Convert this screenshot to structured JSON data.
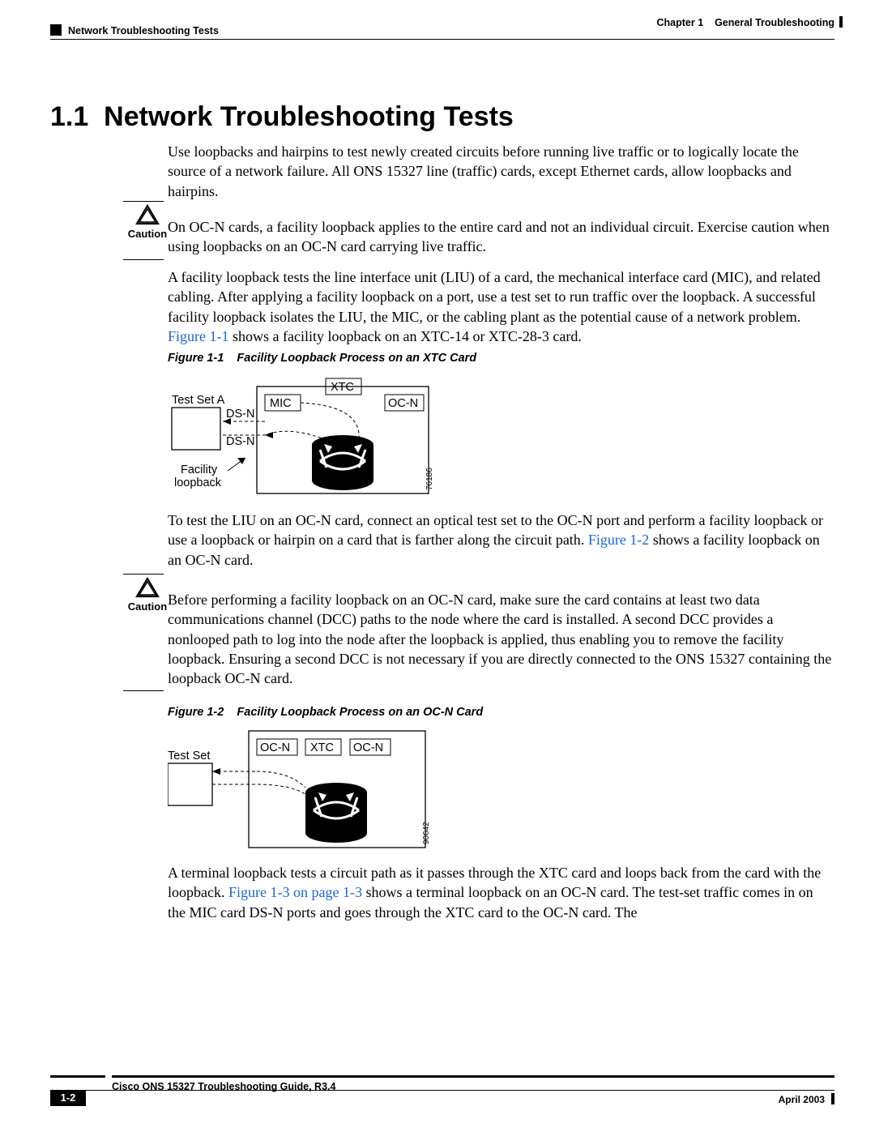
{
  "header": {
    "chapter_label": "Chapter 1",
    "chapter_title": "General Troubleshooting",
    "section": "Network Troubleshooting Tests"
  },
  "heading": {
    "number": "1.1",
    "title": "Network Troubleshooting Tests"
  },
  "paragraphs": {
    "intro": "Use loopbacks and hairpins to test newly created circuits before running live traffic or to logically locate the source of a network failure. All ONS 15327 line (traffic) cards, except Ethernet cards, allow loopbacks and hairpins.",
    "caution1": "On OC-N cards, a facility loopback applies to the entire card and not an individual circuit. Exercise caution when using loopbacks on an OC-N card carrying live traffic.",
    "facility_a": "A facility loopback tests the line interface unit (LIU) of a card, the mechanical interface card (MIC), and related cabling. After applying a facility loopback on a port, use a test set to run traffic over the loopback. A successful facility loopback isolates the LIU, the MIC, or the cabling plant as the potential cause of a network problem. ",
    "facility_ref": "Figure 1-1",
    "facility_b": " shows a facility loopback on an XTC-14 or XTC-28-3 card.",
    "ocn_a": "To test the LIU on an OC-N card, connect an optical test set to the OC-N port and perform a facility loopback or use a loopback or hairpin on a card that is farther along the circuit path. ",
    "ocn_ref": "Figure 1-2",
    "ocn_b": " shows a facility loopback on an OC-N card.",
    "caution2": "Before performing a facility loopback on an OC-N card, make sure the card contains at least two data communications channel (DCC) paths to the node where the card is installed. A second DCC provides a nonlooped path to log into the node after the loopback is applied, thus enabling you to remove the facility loopback. Ensuring a second DCC is not necessary if you are directly connected to the ONS 15327 containing the loopback OC-N card.",
    "terminal_a": "A terminal loopback tests a circuit path as it passes through the XTC card and loops back from the card with the loopback. ",
    "terminal_ref": "Figure 1-3 on page 1-3",
    "terminal_b": " shows a terminal loopback on an OC-N card. The test-set traffic comes in on the MIC card DS-N ports and goes through the XTC card to the OC-N card. The"
  },
  "caution_label": "Caution",
  "figures": {
    "f1": {
      "label": "Figure 1-1",
      "title": "Facility Loopback Process on an XTC Card"
    },
    "f2": {
      "label": "Figure 1-2",
      "title": "Facility Loopback Process on an OC-N Card"
    }
  },
  "diagram1": {
    "test_set": "Test Set A",
    "dsn1": "DS-N",
    "dsn2": "DS-N",
    "facility": "Facility",
    "loopback": "loopback",
    "mic": "MIC",
    "xtc": "XTC",
    "ocn": "OC-N",
    "id": "76186"
  },
  "diagram2": {
    "test_set": "Test Set",
    "ocn1": "OC-N",
    "xtc": "XTC",
    "ocn2": "OC-N",
    "id": "90642"
  },
  "footer": {
    "guide": "Cisco ONS 15327 Troubleshooting Guide, R3.4",
    "page": "1-2",
    "date": "April 2003"
  }
}
